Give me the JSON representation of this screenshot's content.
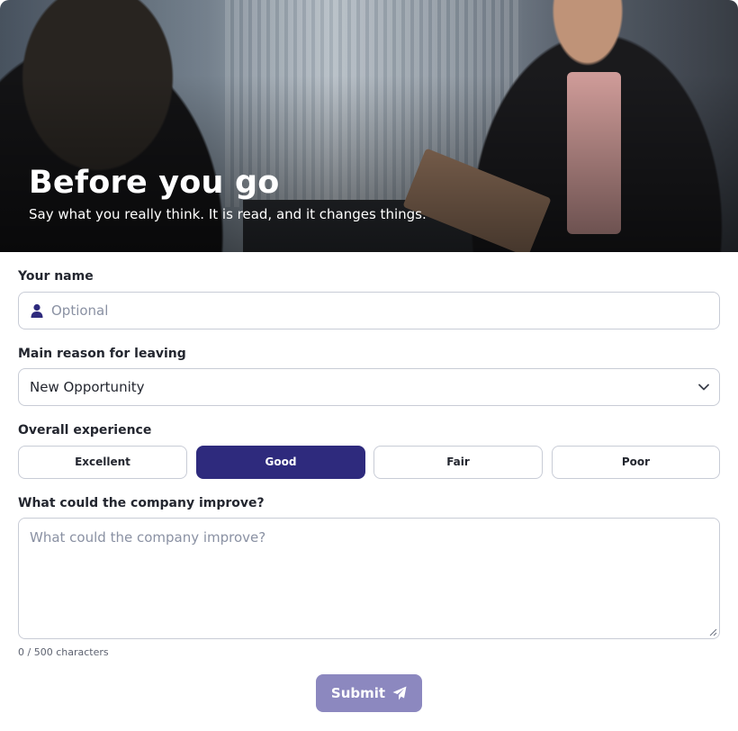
{
  "hero": {
    "title": "Before you go",
    "subtitle": "Say what you really think. It is read, and it changes things."
  },
  "name": {
    "label": "Your name",
    "placeholder": "Optional",
    "value": "",
    "icon": "user-icon"
  },
  "reason": {
    "label": "Main reason for leaving",
    "selected": "New Opportunity",
    "icon": "chevron-down-icon"
  },
  "experience": {
    "label": "Overall experience",
    "options": [
      "Excellent",
      "Good",
      "Fair",
      "Poor"
    ],
    "selected": "Good"
  },
  "improve": {
    "label": "What could the company improve?",
    "placeholder": "What could the company improve?",
    "value": ""
  },
  "counter": "0 / 500 characters",
  "submit": {
    "label": "Submit",
    "icon": "paper-plane-icon"
  },
  "colors": {
    "accent": "#2e2a7d",
    "submit_disabled": "#8c88bf",
    "border": "#c8ccd6",
    "placeholder": "#8a91a3"
  }
}
